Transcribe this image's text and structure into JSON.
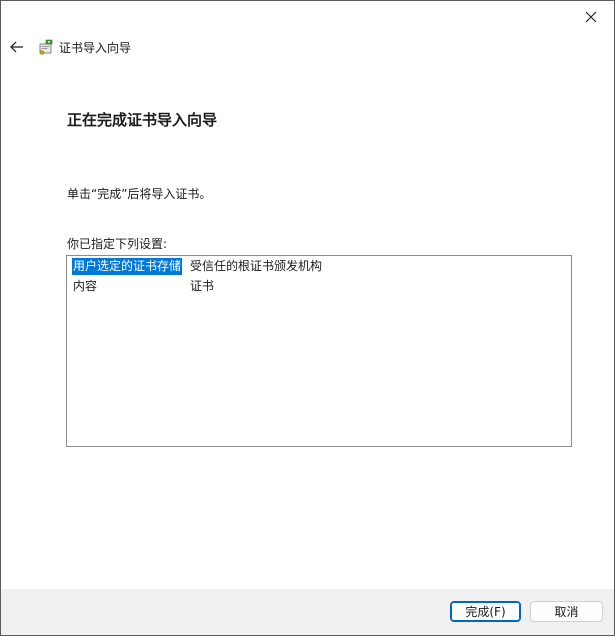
{
  "window": {
    "title": "证书导入向导"
  },
  "page": {
    "heading": "正在完成证书导入向导",
    "instruction": "单击“完成”后将导入证书。",
    "settings_label": "你已指定下列设置:"
  },
  "settings": {
    "rows": [
      {
        "key": "用户选定的证书存储",
        "value": "受信任的根证书颁发机构",
        "selected": true
      },
      {
        "key": "内容",
        "value": "证书",
        "selected": false
      }
    ]
  },
  "buttons": {
    "finish_label": "完成(F)",
    "cancel_label": "取消"
  },
  "colors": {
    "selection": "#0078d7",
    "default_button_border": "#0067c0",
    "footer_background": "#f0f0f0"
  },
  "icons": {
    "close": "close-icon",
    "back": "back-arrow-icon",
    "wizard": "certificate-wizard-icon"
  }
}
